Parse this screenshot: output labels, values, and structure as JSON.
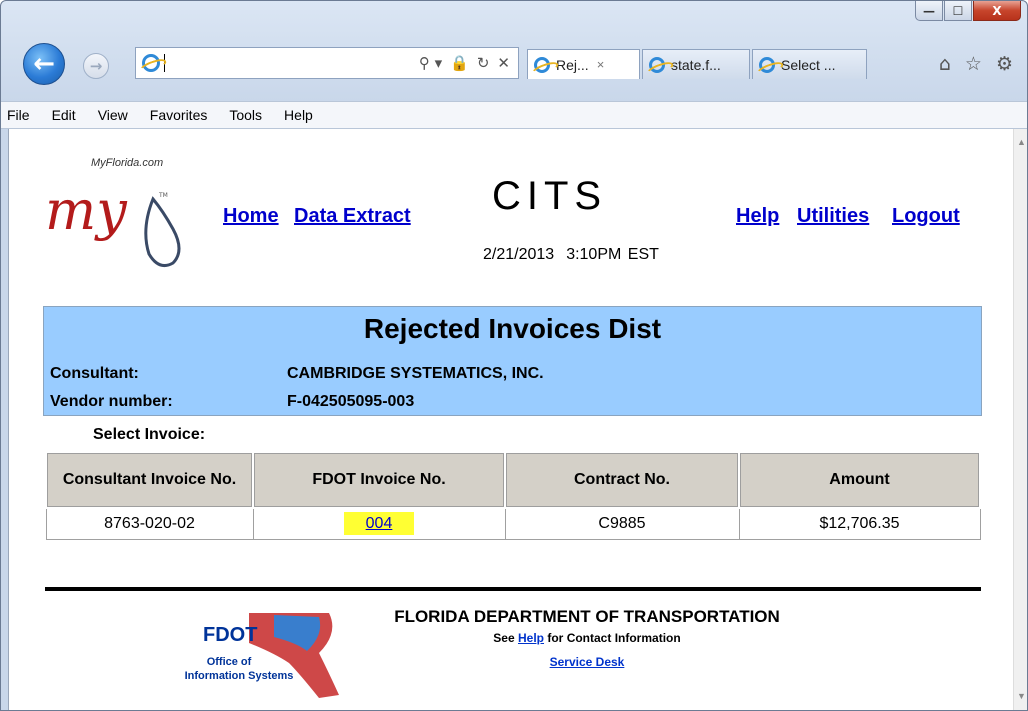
{
  "browser": {
    "window_controls": {
      "minimize": "—",
      "maximize": "☐",
      "close": "X"
    },
    "address_value": "",
    "address_tools": [
      "⚲ ▾",
      "🔒",
      "↻",
      "✕"
    ],
    "tabs": [
      {
        "label": "Rej...",
        "close": "×",
        "active": true
      },
      {
        "label": "state.f...",
        "active": false
      },
      {
        "label": "Select ...",
        "active": false
      }
    ],
    "toolbar_icons": {
      "home": "⌂",
      "favorites": "☆",
      "tools": "⚙"
    },
    "menu": [
      "File",
      "Edit",
      "View",
      "Favorites",
      "Tools",
      "Help"
    ]
  },
  "page": {
    "logo": {
      "url_text": "MyFlorida.com",
      "mark": "my",
      "tm": "TM"
    },
    "nav_left": {
      "home": "Home",
      "data_extract": "Data Extract"
    },
    "app_title": "CITS",
    "date": "2/21/2013",
    "time": "3:10PM EST",
    "nav_right": {
      "help": "Help",
      "utilities": "Utilities",
      "logout": "Logout"
    },
    "header": {
      "title": "Rejected Invoices Dist",
      "consultant_label": "Consultant:",
      "consultant_value": "CAMBRIDGE SYSTEMATICS, INC.",
      "vendor_label": "Vendor number:",
      "vendor_value": "F-042505095-003"
    },
    "select_label": "Select Invoice:",
    "table": {
      "headers": [
        "Consultant Invoice No.",
        "FDOT Invoice No.",
        "Contract No.",
        "Amount"
      ],
      "rows": [
        {
          "consultant_invoice": "8763-020-02",
          "fdot_invoice": "004",
          "contract": "C9885",
          "amount": "$12,706.35"
        }
      ]
    },
    "footer": {
      "logo_fdot": "FDOT",
      "logo_line1": "Office of",
      "logo_line2": "Information Systems",
      "title": "FLORIDA DEPARTMENT OF TRANSPORTATION",
      "contact_prefix": "See",
      "contact_link": "Help",
      "contact_suffix": "for Contact Information",
      "service_desk": "Service Desk"
    }
  },
  "colors": {
    "header_bg": "#99ccff",
    "link": "#0000cc",
    "highlight": "#ffff33",
    "table_header_bg": "#d4d0c8"
  }
}
